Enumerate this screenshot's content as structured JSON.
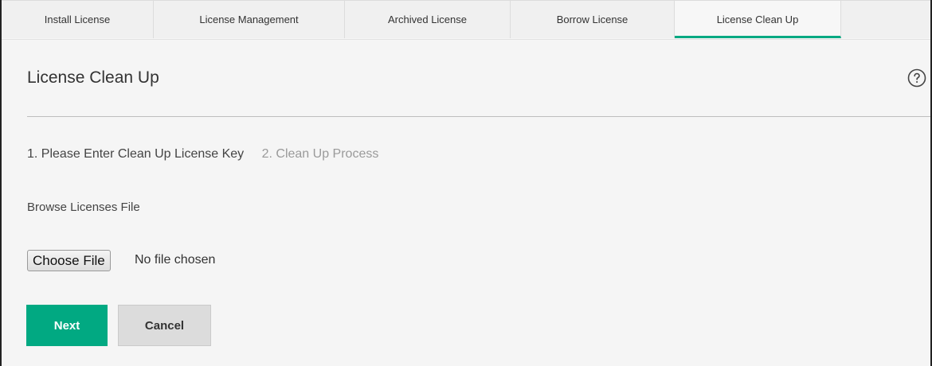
{
  "tabs": [
    {
      "label": "Install License",
      "active": false
    },
    {
      "label": "License Management",
      "active": false
    },
    {
      "label": "Archived License",
      "active": false
    },
    {
      "label": "Borrow License",
      "active": false
    },
    {
      "label": "License Clean Up",
      "active": true
    }
  ],
  "page": {
    "title": "License Clean Up",
    "help_icon": "question-circle-icon"
  },
  "steps": {
    "step1": "1. Please Enter Clean Up License Key",
    "step2": "2. Clean Up Process"
  },
  "form": {
    "browse_label": "Browse Licenses File",
    "choose_file_label": "Choose File",
    "file_status": "No file chosen"
  },
  "actions": {
    "next_label": "Next",
    "cancel_label": "Cancel"
  },
  "colors": {
    "accent": "#01a982",
    "background": "#f5f5f5"
  }
}
